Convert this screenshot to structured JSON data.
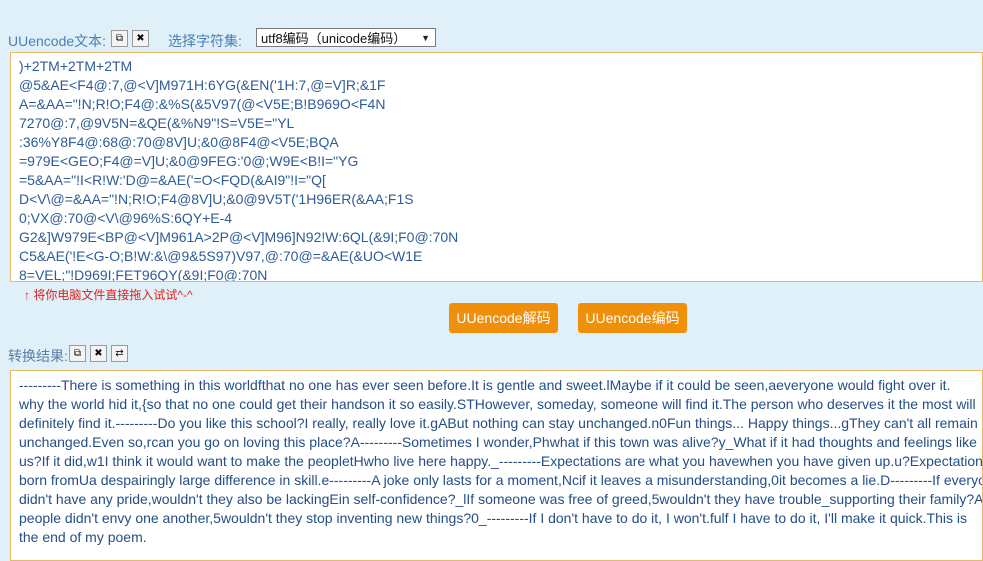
{
  "top": {
    "label": "UUencode文本:",
    "charset_label": "选择字符集:",
    "charset_value": "utf8编码（unicode编码）"
  },
  "encoded_lines": [
    ")+2TM+2TM+2TM",
    "@5&AE<F4@:7,@<V]M971H:6YG(&EN('1H:7,@=V]R;&1F",
    "A=&AA=\"!N;R!O;F4@:&%S(&5V97(@<V5E;B!B969O<F4N",
    "7270@:7,@9V5N=&QE(&%N9\"!S=V5E=\"YL",
    ":36%Y8F4@:68@:70@8V]U;&0@8F4@<V5E;BQA",
    "=979E<GEO;F4@=V]U;&0@9FEG:'0@;W9E<B!I=\"YG",
    "=5&AA=\"!I<R!W:'D@=&AE('=O<FQD(&AI9\"!I=\"Q[",
    "D<V\\@=&AA=\"!N;R!O;F4@8V]U;&0@9V5T('1H96ER(&AA;F1S",
    "0;VX@:70@<V\\@96%S:6QY+E-4",
    "G2&]W979E<BP@<V]M961A>2P@<V]M96]N92!W:6QL(&9I;F0@:70N",
    "C5&AE('!E<G-O;B!W:&\\@9&5S97)V97,@:70@=&AE(&UO<W1E",
    "8=VEL;\"!D969I;FET96QY(&9I;F0@:70N"
  ],
  "hint": "↑ 将你电脑文件直接拖入试试^-^",
  "buttons": {
    "decode": "UUencode解码",
    "encode": "UUencode编码"
  },
  "result": {
    "label": "转换结果:",
    "lines": [
      "---------There is something in this worldfthat no one has ever seen before.It is gentle and sweet.lMaybe if it could be seen,aeveryone would fight over it.",
      "why the world hid it,{so that no one could get their handson it so easily.STHowever, someday, someone will find it.The person who deserves it the most will",
      "definitely find it.---------Do you like this school?I really, really love it.gABut nothing can stay unchanged.n0Fun things... Happy things...gThey can't all remain",
      "unchanged.Even so,rcan you go on loving this place?A---------Sometimes I wonder,Phwhat if this town was alive?y_What if it had thoughts and feelings like",
      "us?If it did,w1I think it would want to make the peopletHwho live here happy._---------Expectations are what you havewhen you have given up.u?Expectations are",
      "born fromUa despairingly large difference in skill.e---------A joke only lasts for a moment,Ncif it leaves a misunderstanding,0it becomes a lie.D---------If everyone",
      "didn't have any pride,wouldn't they also be lackingEin self-confidence?_lIf someone was free of greed,5wouldn't they have trouble_supporting their family?And if",
      "people didn't envy one another,5wouldn't they stop inventing new things?0_---------If I don't have to do it, I won't.fulf I have to do it, I'll make it quick.This is",
      "the end of my poem."
    ]
  }
}
